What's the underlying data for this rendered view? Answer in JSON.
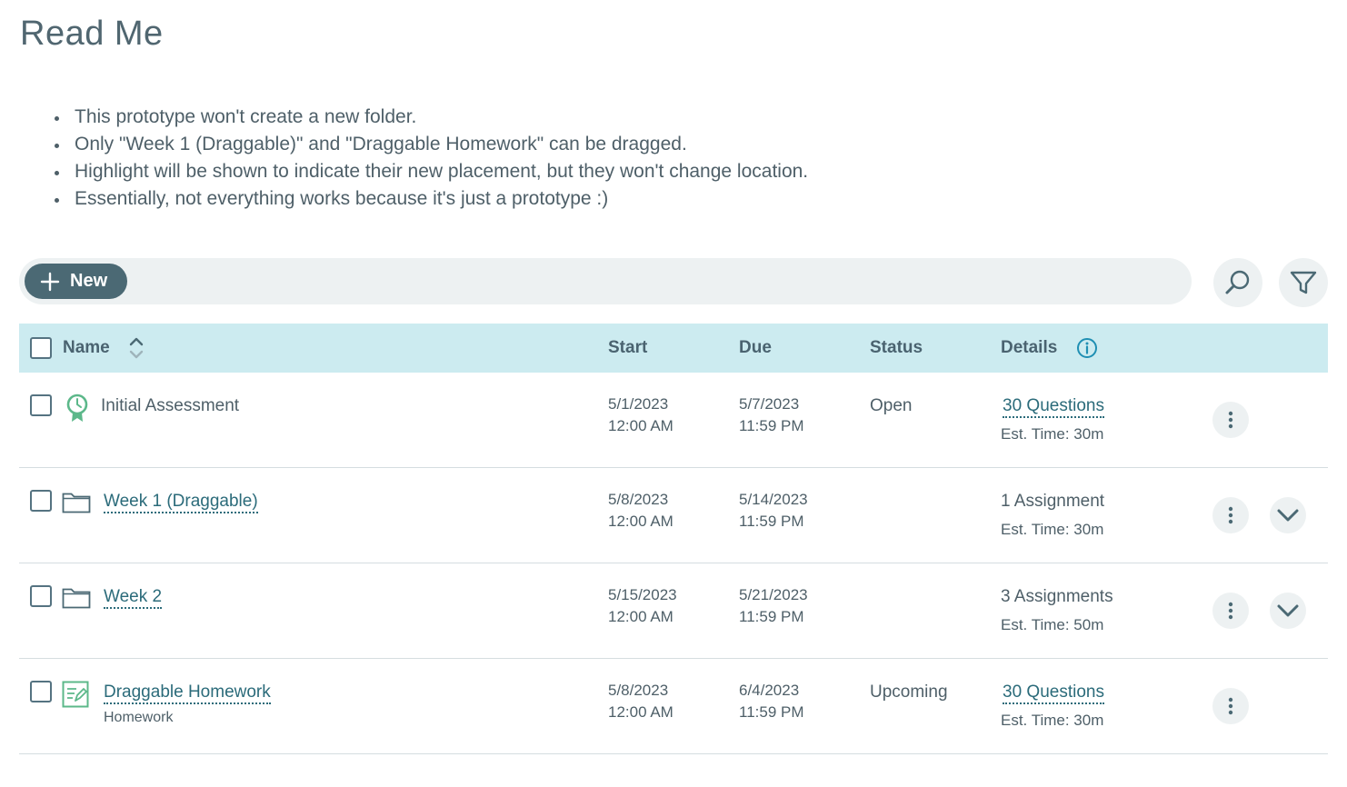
{
  "page": {
    "title": "Read Me"
  },
  "notes": [
    "This prototype won't create a new folder.",
    "Only \"Week 1 (Draggable)\" and \"Draggable Homework\" can be dragged.",
    "Highlight will be shown to indicate their new placement, but they won't change location.",
    "Essentially, not everything works because it's just a prototype :)"
  ],
  "toolbar": {
    "new_label": "New",
    "search_icon": "search-icon",
    "filter_icon": "filter-icon"
  },
  "table": {
    "headers": {
      "name": "Name",
      "start": "Start",
      "due": "Due",
      "status": "Status",
      "details": "Details"
    },
    "rows": [
      {
        "icon": "assessment-icon",
        "name": "Initial Assessment",
        "subtitle": "",
        "is_link": false,
        "start_date": "5/1/2023",
        "start_time": "12:00 AM",
        "due_date": "5/7/2023",
        "due_time": "11:59 PM",
        "status": "Open",
        "details": "30 Questions",
        "details_link": true,
        "est": "Est. Time: 30m",
        "expandable": false
      },
      {
        "icon": "folder-icon",
        "name": "Week 1 (Draggable)",
        "subtitle": "",
        "is_link": true,
        "start_date": "5/8/2023",
        "start_time": "12:00 AM",
        "due_date": "5/14/2023",
        "due_time": "11:59 PM",
        "status": "",
        "details": "1 Assignment",
        "details_link": false,
        "est": "Est. Time: 30m",
        "expandable": true
      },
      {
        "icon": "folder-icon",
        "name": "Week 2",
        "subtitle": "",
        "is_link": true,
        "start_date": "5/15/2023",
        "start_time": "12:00 AM",
        "due_date": "5/21/2023",
        "due_time": "11:59 PM",
        "status": "",
        "details": "3 Assignments",
        "details_link": false,
        "est": "Est. Time: 50m",
        "expandable": true
      },
      {
        "icon": "homework-icon",
        "name": "Draggable Homework",
        "subtitle": "Homework",
        "is_link": true,
        "start_date": "5/8/2023",
        "start_time": "12:00 AM",
        "due_date": "6/4/2023",
        "due_time": "11:59 PM",
        "status": "Upcoming",
        "details": "30 Questions",
        "details_link": true,
        "est": "Est. Time: 30m",
        "expandable": false
      }
    ]
  },
  "colors": {
    "accent": "#4b6974",
    "header_bg": "#ccebf0",
    "link": "#2b6b7a",
    "icon_green": "#5cb88a"
  }
}
